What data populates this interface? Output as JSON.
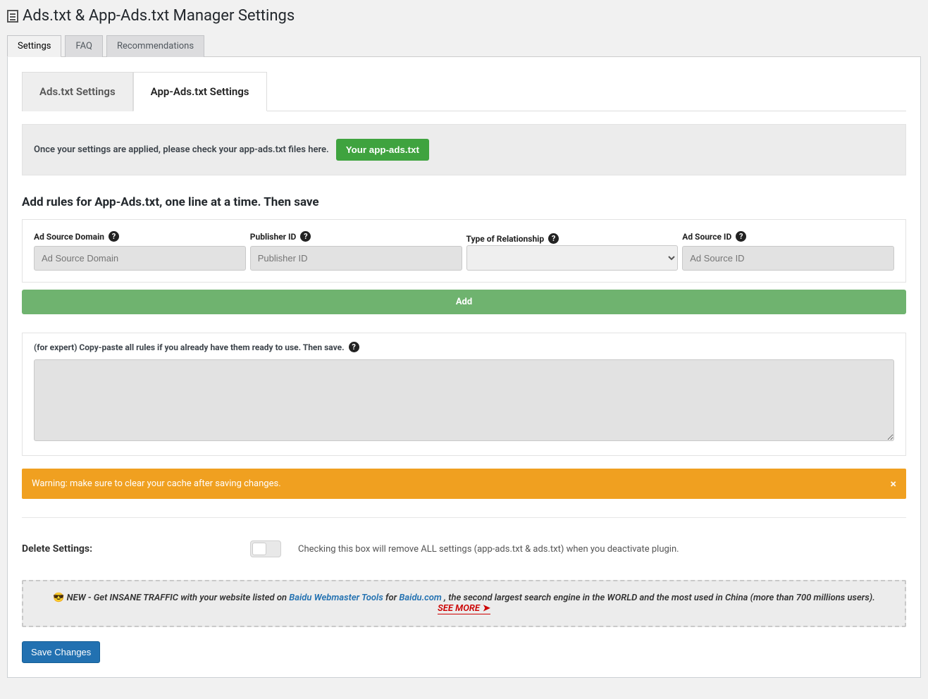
{
  "page_title": "Ads.txt & App-Ads.txt Manager Settings",
  "nav_tabs": {
    "settings": "Settings",
    "faq": "FAQ",
    "recommendations": "Recommendations"
  },
  "sub_tabs": {
    "ads": "Ads.txt Settings",
    "app_ads": "App-Ads.txt Settings"
  },
  "check_bar": {
    "text": "Once your settings are applied, please check your app-ads.txt files here.",
    "button": "Your app-ads.txt"
  },
  "section_heading": "Add rules for App-Ads.txt, one line at a time. Then save",
  "fields": {
    "domain": {
      "label": "Ad Source Domain",
      "placeholder": "Ad Source Domain"
    },
    "publisher": {
      "label": "Publisher ID",
      "placeholder": "Publisher ID"
    },
    "relationship": {
      "label": "Type of Relationship"
    },
    "source_id": {
      "label": "Ad Source ID",
      "placeholder": "Ad Source ID"
    }
  },
  "add_button": "Add",
  "expert": {
    "label": "(for expert) Copy-paste all rules if you already have them ready to use. Then save."
  },
  "warning": {
    "text": "Warning: make sure to clear your cache after saving changes.",
    "close": "×"
  },
  "delete": {
    "label": "Delete Settings:",
    "help": "Checking this box will remove ALL settings (app-ads.txt & ads.txt) when you deactivate plugin."
  },
  "promo": {
    "prefix": "NEW - Get INSANE TRAFFIC with your website listed on ",
    "link1": "Baidu Webmaster Tools",
    "mid1": " for ",
    "link2": "Baidu.com",
    "suffix": ", the second largest search engine in the WORLD and the most used in China (more than 700 millions users). ",
    "see_more": "SEE MORE"
  },
  "save_button": "Save Changes"
}
